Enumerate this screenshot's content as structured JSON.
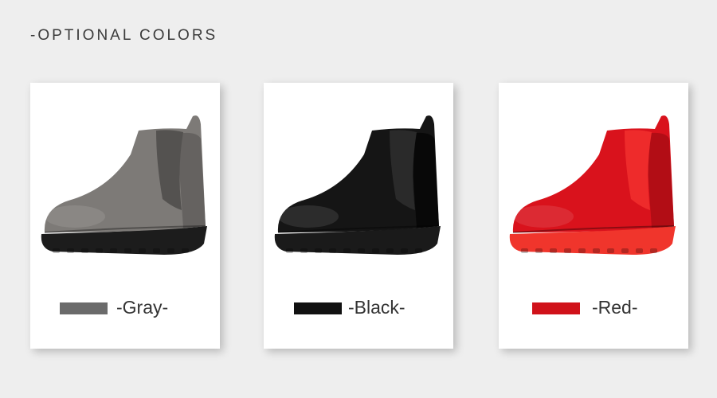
{
  "heading": "-OPTIONAL  COLORS",
  "colors": [
    {
      "label": "-Gray-",
      "swatch": "#6b6b6b",
      "upper": "#7d7a77",
      "upper_shade": "#5f5c5a",
      "elastic": "#545250",
      "sole": "#1c1c1c"
    },
    {
      "label": "-Black-",
      "swatch": "#111111",
      "upper": "#151515",
      "upper_shade": "#050505",
      "elastic": "#2a2a2a",
      "sole": "#1a1a1a"
    },
    {
      "label": "-Red-",
      "swatch": "#d0121a",
      "upper": "#d9121c",
      "upper_shade": "#a80d14",
      "elastic": "#ee2b2b",
      "sole": "#f0352c"
    }
  ]
}
